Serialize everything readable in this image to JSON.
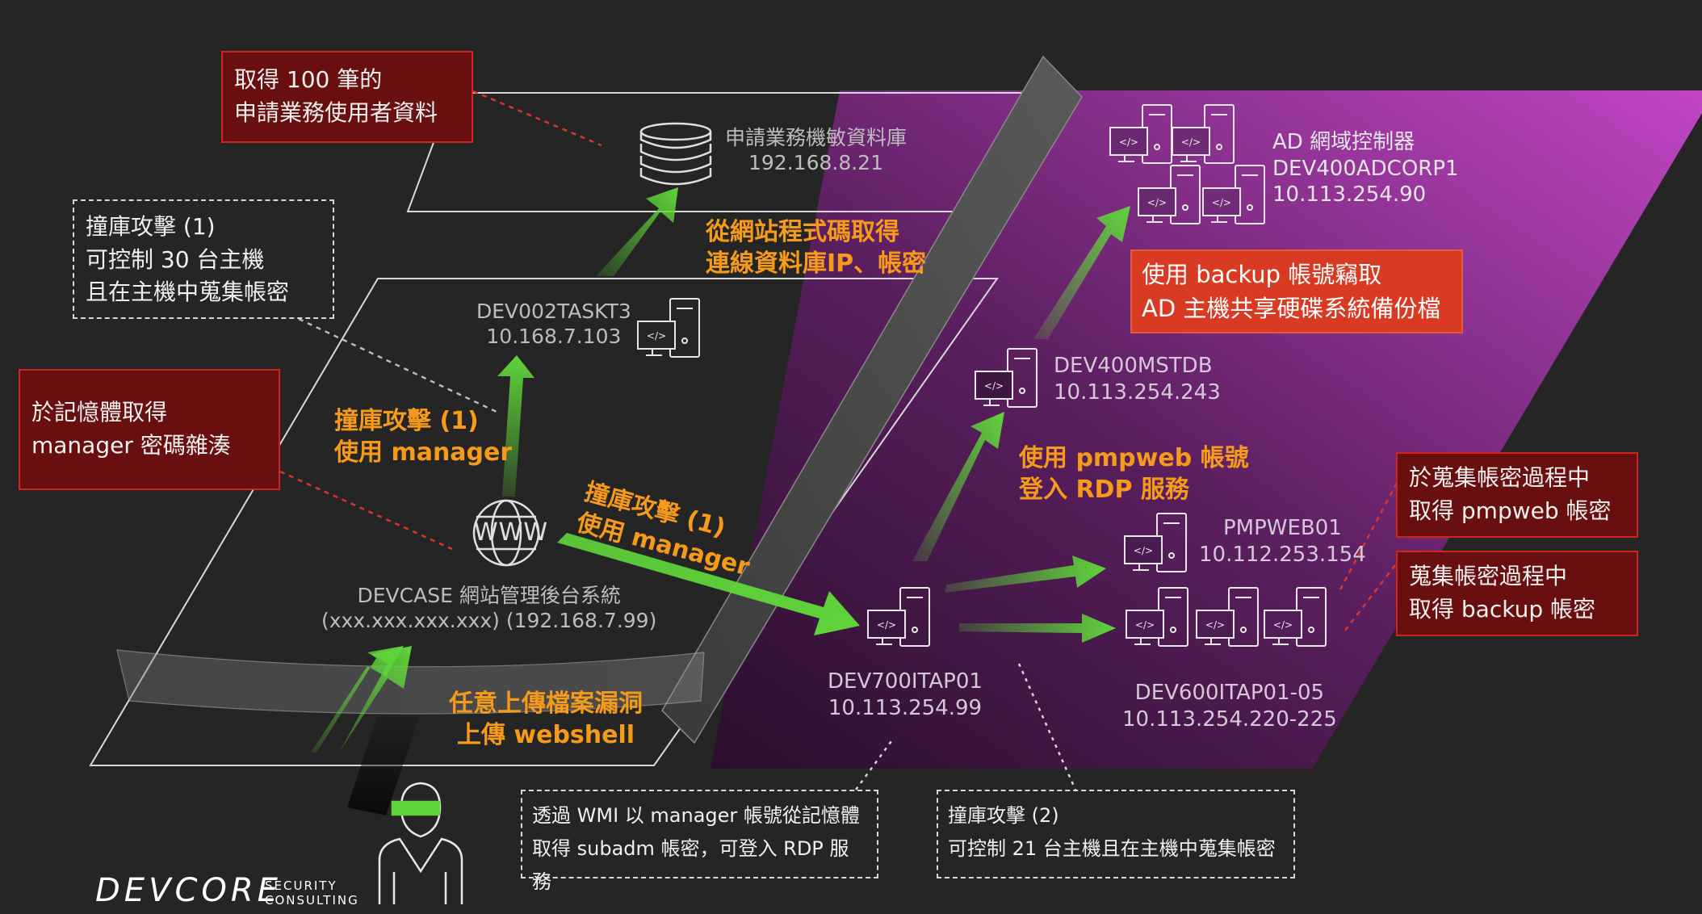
{
  "nodes": {
    "sensitive_db": {
      "name": "申請業務機敏資料庫",
      "ip": "192.168.8.21"
    },
    "task": {
      "name": "DEV002TASKT3",
      "ip": "10.168.7.103"
    },
    "devcase": {
      "name": "DEVCASE 網站管理後台系統",
      "ip": "(xxx.xxx.xxx.xxx) (192.168.7.99)"
    },
    "www_label": "WWW",
    "ad": {
      "line1": "AD 網域控制器",
      "line2": "DEV400ADCORP1",
      "line3": "10.113.254.90"
    },
    "mstdb": {
      "name": "DEV400MSTDB",
      "ip": "10.113.254.243"
    },
    "pmpweb": {
      "name": "PMPWEB01",
      "ip": "10.112.253.154"
    },
    "itap01": {
      "name": "DEV700ITAP01",
      "ip": "10.113.254.99"
    },
    "itap0105": {
      "name": "DEV600ITAP01-05",
      "ip": "10.113.254.220-225"
    }
  },
  "steps": {
    "upload": {
      "line1": "任意上傳檔案漏洞",
      "line2": "上傳 webshell"
    },
    "stuffing_task": {
      "line1": "撞庫攻擊 (1)",
      "line2": "使用 manager"
    },
    "stuffing_itap": {
      "line1": "撞庫攻擊 (1)",
      "line2": "使用 manager"
    },
    "db_creds": {
      "line1": "從網站程式碼取得",
      "line2": "連線資料庫IP、帳密"
    },
    "rdp": {
      "line1": "使用 pmpweb 帳號",
      "line2": "登入 RDP 服務"
    }
  },
  "callouts": {
    "records": {
      "line1": "取得 100 筆的",
      "line2": "申請業務使用者資料"
    },
    "stuffing1": {
      "line1": "撞庫攻擊 (1)",
      "line2": "可控制 30 台主機",
      "line3": "且在主機中蒐集帳密"
    },
    "memory": {
      "line1": "於記憶體取得",
      "line2": "manager 密碼雜湊"
    },
    "backup_share": {
      "line1": "使用 backup 帳號竊取",
      "line2": "AD 主機共享硬碟系統備份檔"
    },
    "pmpweb_acct": {
      "line1": "於蒐集帳密過程中",
      "line2": "取得 pmpweb 帳密"
    },
    "backup_acct": {
      "line1": "蒐集帳密過程中",
      "line2": "取得 backup 帳密"
    },
    "wmi": {
      "line1": "透過 WMI 以 manager 帳號從記憶體",
      "line2": "取得 subadm 帳密，可登入 RDP 服務"
    },
    "stuffing2": {
      "line1": "撞庫攻擊 (2)",
      "line2": "可控制 21 台主機且在主機中蒐集帳密"
    }
  },
  "logo": {
    "name": "DEVCORE",
    "sub1": "SECURITY",
    "sub2": "CONSULTING"
  },
  "colors": {
    "background": "#252525",
    "arrow": "#5fd43a",
    "orange_text": "#f59a1a",
    "callout_red": "#6a0f10",
    "callout_bright": "#d93a22",
    "purple": "#b23ab8"
  }
}
